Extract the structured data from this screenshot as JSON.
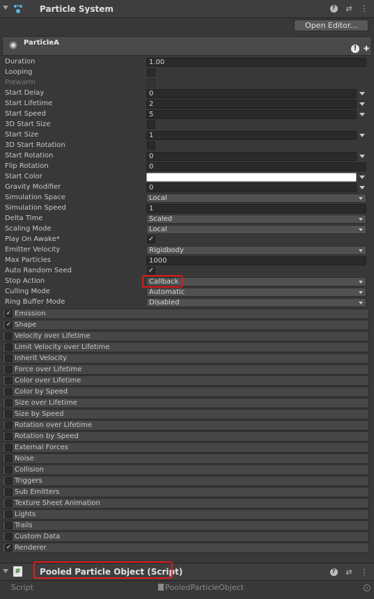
{
  "component1": {
    "title": "Particle System",
    "help_icon": "help-icon",
    "preset_icon": "preset-icon",
    "menu_icon": "kebab-menu-icon"
  },
  "open_editor_label": "Open Editor...",
  "system_name": "ParticleA",
  "props": {
    "duration": {
      "label": "Duration",
      "value": "1.00"
    },
    "looping": {
      "label": "Looping",
      "checked": false
    },
    "prewarm": {
      "label": "Prewarm",
      "checked": false
    },
    "start_delay": {
      "label": "Start Delay",
      "value": "0"
    },
    "start_lifetime": {
      "label": "Start Lifetime",
      "value": "2"
    },
    "start_speed": {
      "label": "Start Speed",
      "value": "5"
    },
    "start_size_3d": {
      "label": "3D Start Size",
      "checked": false
    },
    "start_size": {
      "label": "Start Size",
      "value": "1"
    },
    "start_rotation_3d": {
      "label": "3D Start Rotation",
      "checked": false
    },
    "start_rotation": {
      "label": "Start Rotation",
      "value": "0"
    },
    "flip_rotation": {
      "label": "Flip Rotation",
      "value": "0"
    },
    "start_color": {
      "label": "Start Color",
      "color": "#ffffff"
    },
    "gravity_modifier": {
      "label": "Gravity Modifier",
      "value": "0"
    },
    "simulation_space": {
      "label": "Simulation Space",
      "value": "Local"
    },
    "simulation_speed": {
      "label": "Simulation Speed",
      "value": "1"
    },
    "delta_time": {
      "label": "Delta Time",
      "value": "Scaled"
    },
    "scaling_mode": {
      "label": "Scaling Mode",
      "value": "Local"
    },
    "play_on_awake": {
      "label": "Play On Awake*",
      "checked": true,
      "check": "✓"
    },
    "emitter_velocity": {
      "label": "Emitter Velocity",
      "value": "Rigidbody"
    },
    "max_particles": {
      "label": "Max Particles",
      "value": "1000"
    },
    "auto_random_seed": {
      "label": "Auto Random Seed",
      "checked": true,
      "check": "✓"
    },
    "stop_action": {
      "label": "Stop Action",
      "value": "Callback"
    },
    "culling_mode": {
      "label": "Culling Mode",
      "value": "Automatic"
    },
    "ring_buffer_mode": {
      "label": "Ring Buffer Mode",
      "value": "Disabled"
    }
  },
  "modules": [
    {
      "label": "Emission",
      "checked": true
    },
    {
      "label": "Shape",
      "checked": true
    },
    {
      "label": "Velocity over Lifetime",
      "checked": false
    },
    {
      "label": "Limit Velocity over Lifetime",
      "checked": false
    },
    {
      "label": "Inherit Velocity",
      "checked": false
    },
    {
      "label": "Force over Lifetime",
      "checked": false
    },
    {
      "label": "Color over Lifetime",
      "checked": false
    },
    {
      "label": "Color by Speed",
      "checked": false
    },
    {
      "label": "Size over Lifetime",
      "checked": false
    },
    {
      "label": "Size by Speed",
      "checked": false
    },
    {
      "label": "Rotation over Lifetime",
      "checked": false
    },
    {
      "label": "Rotation by Speed",
      "checked": false
    },
    {
      "label": "External Forces",
      "checked": false
    },
    {
      "label": "Noise",
      "checked": false
    },
    {
      "label": "Collision",
      "checked": false
    },
    {
      "label": "Triggers",
      "checked": false
    },
    {
      "label": "Sub Emitters",
      "checked": false
    },
    {
      "label": "Texture Sheet Animation",
      "checked": false
    },
    {
      "label": "Lights",
      "checked": false
    },
    {
      "label": "Trails",
      "checked": false
    },
    {
      "label": "Custom Data",
      "checked": false
    },
    {
      "label": "Renderer",
      "checked": true
    }
  ],
  "check_glyph": "✓",
  "component2": {
    "title": "Pooled Particle Object (Script)",
    "icon": "hash-script-icon"
  },
  "script": {
    "label": "Script",
    "value": "PooledParticleObject"
  },
  "highlight_color": "#e11b1b"
}
